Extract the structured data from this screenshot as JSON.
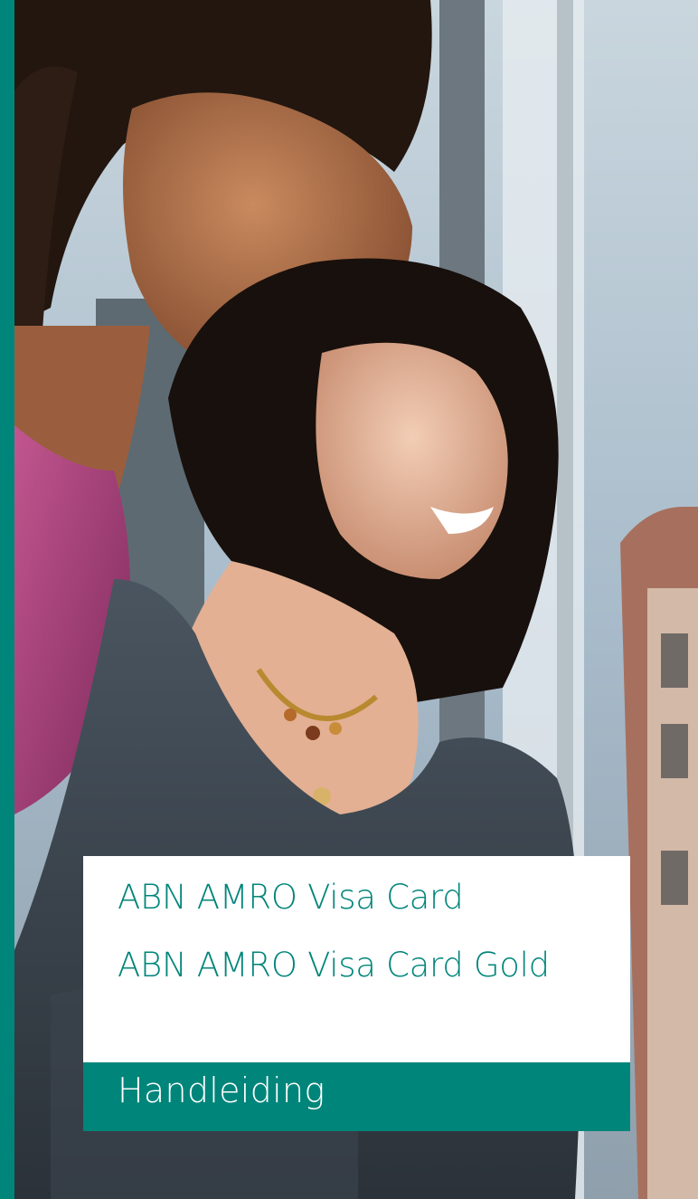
{
  "cover": {
    "title_line_1": "ABN AMRO Visa Card",
    "title_line_2": "ABN AMRO Visa Card Gold",
    "subtitle": "Handleiding",
    "photo": "two-smiling-women-at-window-photo"
  },
  "colors": {
    "brand_green": "#00857a",
    "panel_white": "#ffffff"
  }
}
